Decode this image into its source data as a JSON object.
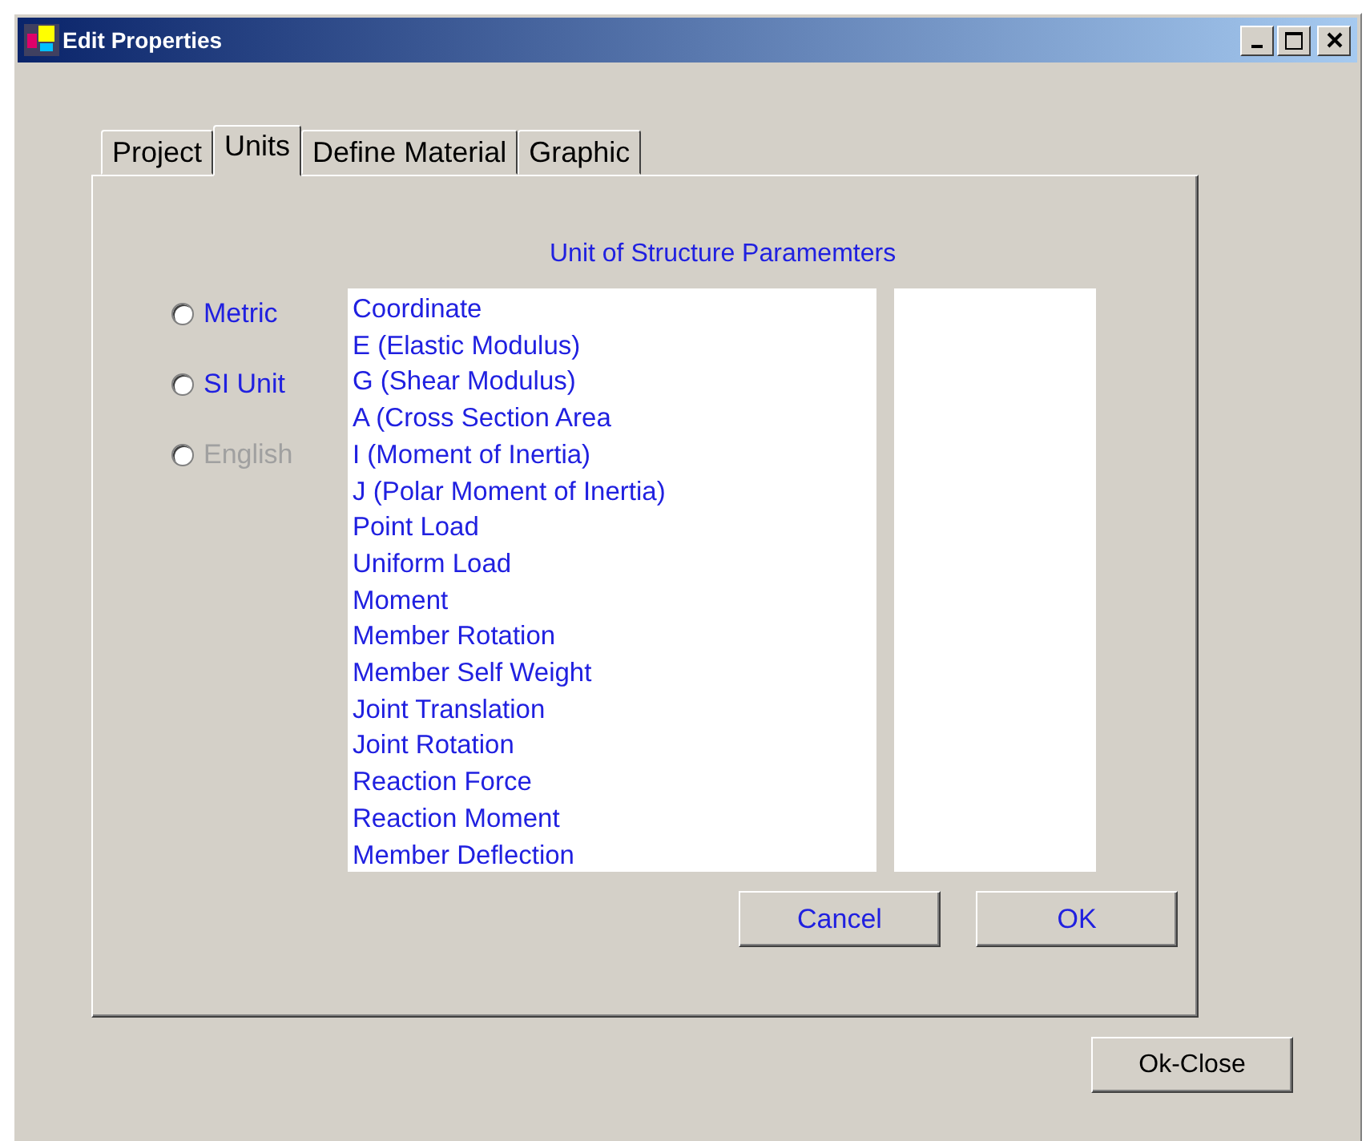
{
  "window": {
    "title": "Edit Properties"
  },
  "tabs": [
    {
      "label": "Project",
      "selected": false
    },
    {
      "label": "Units",
      "selected": true
    },
    {
      "label": "Define Material",
      "selected": false
    },
    {
      "label": "Graphic",
      "selected": false
    }
  ],
  "units_panel": {
    "heading": "Unit of Structure Paramemters",
    "unit_systems": [
      {
        "label": "Metric",
        "selected": false,
        "disabled": false
      },
      {
        "label": "SI Unit",
        "selected": false,
        "disabled": false
      },
      {
        "label": "English",
        "selected": false,
        "disabled": true
      }
    ],
    "parameters": [
      "Coordinate",
      "E (Elastic Modulus)",
      "G (Shear Modulus)",
      "A (Cross Section Area",
      "I (Moment of Inertia)",
      "J (Polar Moment of Inertia)",
      "Point Load",
      "Uniform Load",
      "Moment",
      "Member Rotation",
      "Member Self Weight",
      "Joint Translation",
      "Joint Rotation",
      "Reaction Force",
      "Reaction Moment",
      "Member Deflection"
    ],
    "buttons": [
      "Cancel",
      "OK"
    ]
  },
  "footer_button": "Ok-Close"
}
